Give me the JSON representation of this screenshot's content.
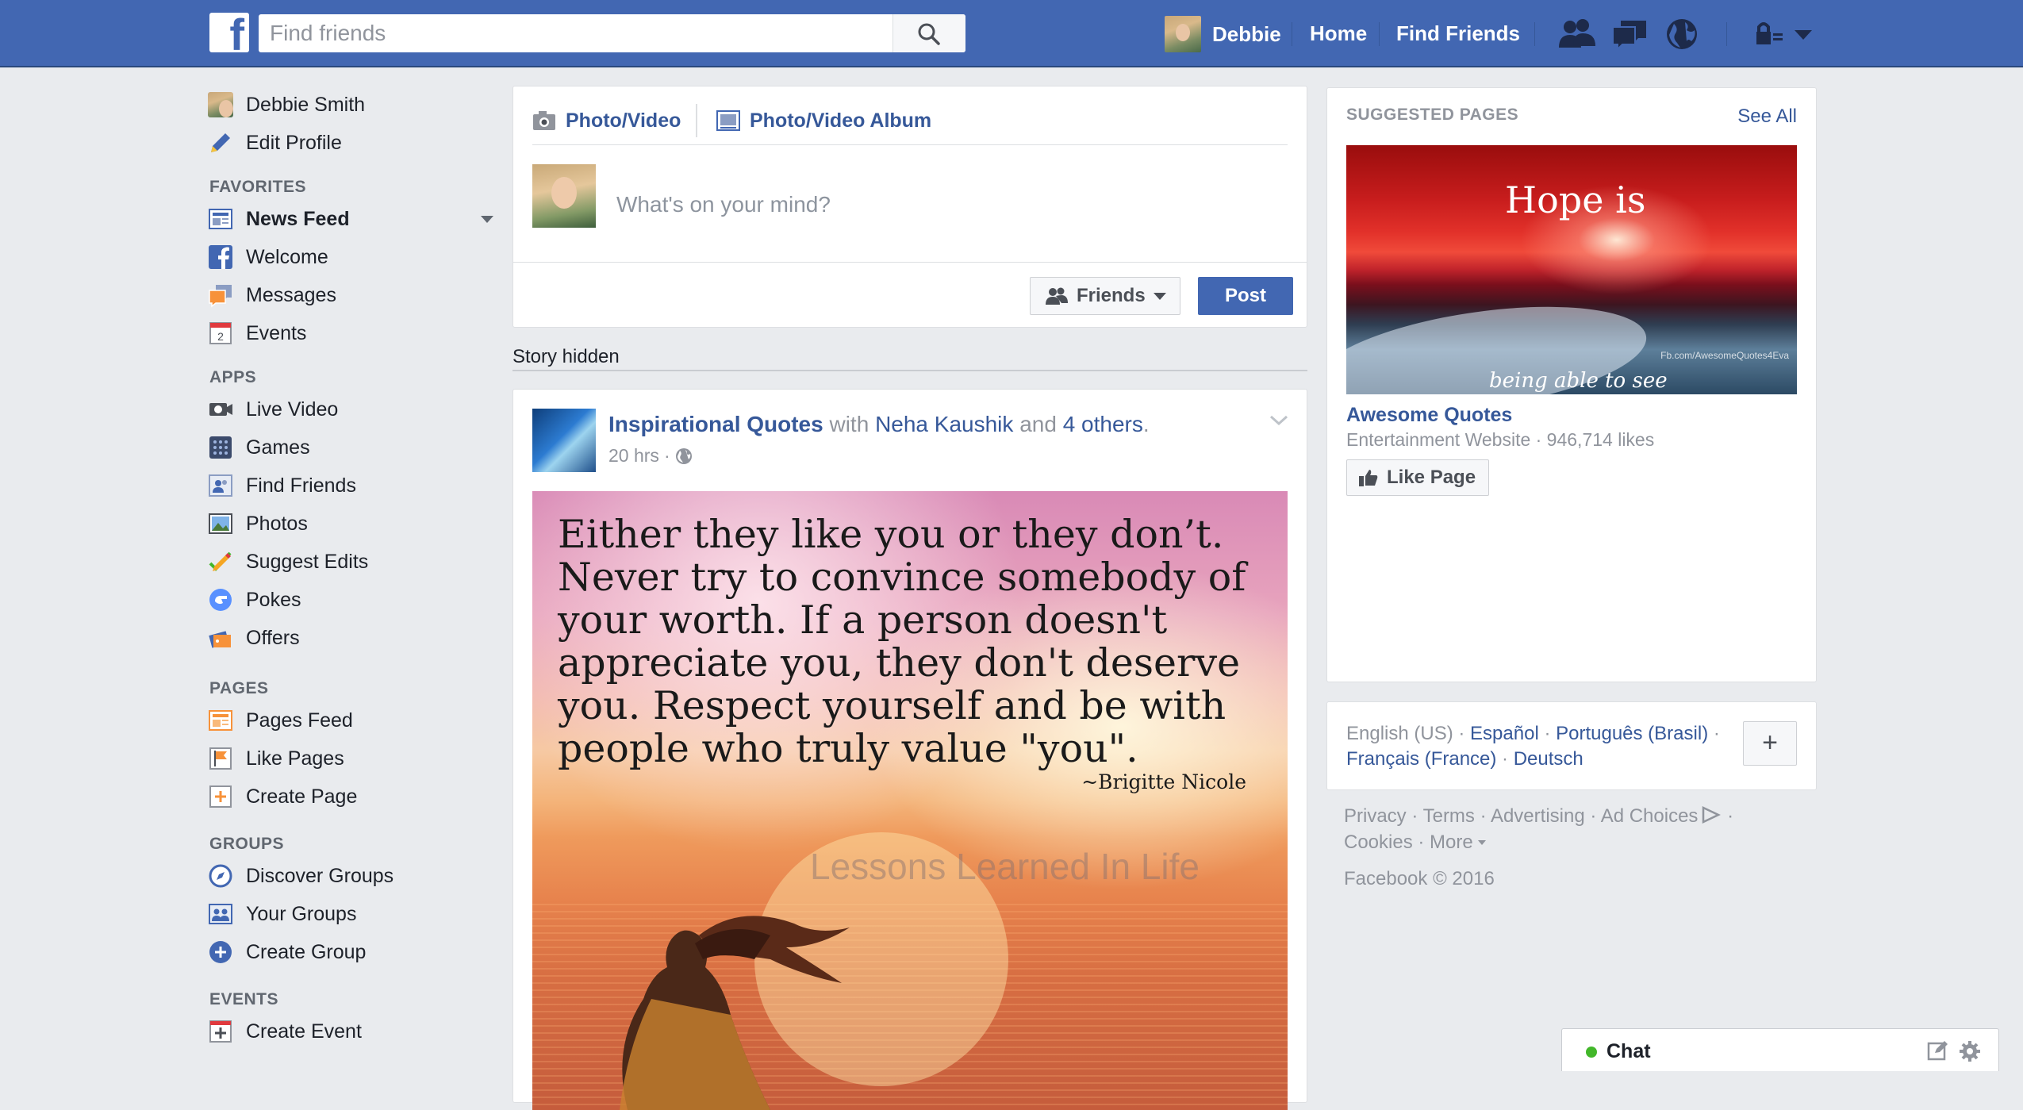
{
  "topbar": {
    "logo_letter": "f",
    "search_placeholder": "Find friends",
    "user_name": "Debbie",
    "home_label": "Home",
    "find_friends_label": "Find Friends",
    "icons": [
      "friend-requests-icon",
      "messages-icon",
      "notifications-globe-icon",
      "privacy-lock-icon",
      "account-caret-icon"
    ]
  },
  "leftnav": {
    "profile": [
      {
        "label": "Debbie Smith",
        "icon": "profile-avatar"
      },
      {
        "label": "Edit Profile",
        "icon": "pencil-icon"
      }
    ],
    "sections": [
      {
        "title": "FAVORITES",
        "items": [
          {
            "label": "News Feed",
            "icon": "news-feed-icon",
            "selected": true
          },
          {
            "label": "Welcome",
            "icon": "facebook-icon"
          },
          {
            "label": "Messages",
            "icon": "messages-icon"
          },
          {
            "label": "Events",
            "icon": "calendar-icon",
            "badge": "2"
          }
        ]
      },
      {
        "title": "APPS",
        "items": [
          {
            "label": "Live Video",
            "icon": "video-camera-icon"
          },
          {
            "label": "Games",
            "icon": "games-icon"
          },
          {
            "label": "Find Friends",
            "icon": "find-friends-icon"
          },
          {
            "label": "Photos",
            "icon": "photos-icon"
          },
          {
            "label": "Suggest Edits",
            "icon": "suggest-edits-icon"
          },
          {
            "label": "Pokes",
            "icon": "pokes-icon"
          },
          {
            "label": "Offers",
            "icon": "offers-icon"
          }
        ]
      },
      {
        "title": "PAGES",
        "items": [
          {
            "label": "Pages Feed",
            "icon": "pages-feed-icon"
          },
          {
            "label": "Like Pages",
            "icon": "flag-icon"
          },
          {
            "label": "Create Page",
            "icon": "create-page-icon"
          }
        ]
      },
      {
        "title": "GROUPS",
        "items": [
          {
            "label": "Discover Groups",
            "icon": "compass-icon"
          },
          {
            "label": "Your Groups",
            "icon": "groups-icon"
          },
          {
            "label": "Create Group",
            "icon": "plus-circle-icon"
          }
        ]
      },
      {
        "title": "EVENTS",
        "items": [
          {
            "label": "Create Event",
            "icon": "create-event-icon"
          }
        ]
      }
    ]
  },
  "composer": {
    "tab_photo": "Photo/Video",
    "tab_album": "Photo/Video Album",
    "placeholder": "What's on your mind?",
    "audience": "Friends",
    "post_label": "Post"
  },
  "feed": {
    "story_hidden": "Story hidden",
    "post": {
      "page_name": "Inspirational Quotes",
      "with_word": "with",
      "tagged": "Neha Kaushik",
      "and_word": "and",
      "others": "4 others",
      "period": ".",
      "time": "20 hrs",
      "separator": "·",
      "quote_lines": [
        "Either they like you or they don’t.",
        "Never try to convince somebody of",
        "your worth.  If a person doesn't",
        "appreciate you, they don't deserve",
        "you.  Respect yourself and be with",
        "people who  truly value \"you\"."
      ],
      "quote_author": "~Brigitte Nicole",
      "watermark": "Lessons Learned In Life"
    }
  },
  "suggested": {
    "title": "SUGGESTED PAGES",
    "see_all": "See All",
    "image_text": "Hope is",
    "image_footer": "being able to see",
    "image_credit": "Fb.com/AwesomeQuotes4Eva",
    "page_name": "Awesome Quotes",
    "subtitle": "Entertainment Website · 946,714 likes",
    "like_label": "Like Page"
  },
  "languages": {
    "current": "English (US)",
    "links": [
      "Español",
      "Português (Brasil)",
      "Français (France)",
      "Deutsch"
    ],
    "dot": " · ",
    "plus": "+"
  },
  "footer": {
    "links": [
      "Privacy",
      "Terms",
      "Advertising",
      "Ad Choices",
      "Cookies",
      "More"
    ],
    "copyright": "Facebook © 2016"
  },
  "chat": {
    "label": "Chat"
  },
  "colors": {
    "brand": "#4267b2",
    "link": "#365899",
    "online": "#42b72a",
    "page_bg": "#e9ebee"
  }
}
